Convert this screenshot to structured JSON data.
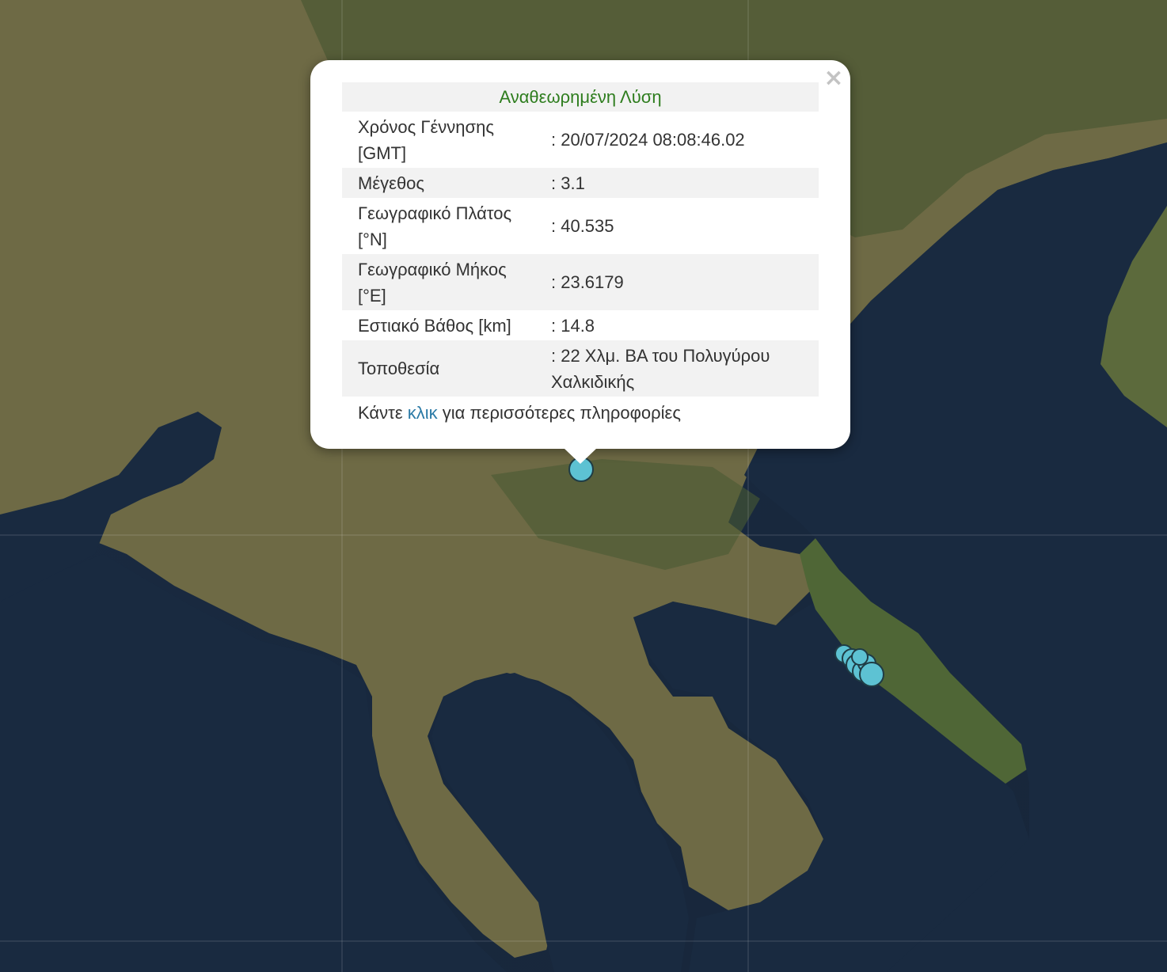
{
  "popup": {
    "header": "Αναθεωρημένη Λύση",
    "close_symbol": "×",
    "rows": [
      {
        "label": "Χρόνος Γέννησης [GMT]",
        "value": ": 20/07/2024 08:08:46.02"
      },
      {
        "label": "Μέγεθος",
        "value": ": 3.1"
      },
      {
        "label": "Γεωγραφικό Πλάτος [°N]",
        "value": ": 40.535"
      },
      {
        "label": "Γεωγραφικό Μήκος [°E]",
        "value": ": 23.6179"
      },
      {
        "label": "Εστιακό Βάθος [km]",
        "value": ": 14.8"
      },
      {
        "label": "Τοποθεσία",
        "value": ": 22 Χλμ. ΒΑ του Πολυγύρου Χαλκιδικής"
      }
    ],
    "footer_before": "Κάντε",
    "footer_link": "κλικ",
    "footer_after": "για περισσότερες πληροφορίες"
  },
  "map": {
    "basemap": "satellite imagery",
    "marker_color": "#56c4d6",
    "header_color": "#2e7d1e",
    "link_color": "#2a7aa6"
  }
}
